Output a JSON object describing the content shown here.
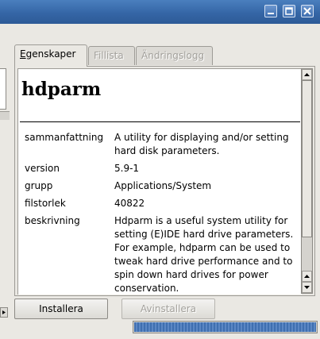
{
  "window": {
    "buttons": [
      {
        "name": "minimize-button",
        "icon": "minimize-icon"
      },
      {
        "name": "maximize-button",
        "icon": "maximize-icon"
      },
      {
        "name": "close-button",
        "icon": "close-icon"
      }
    ]
  },
  "tabs": [
    {
      "label": "Egenskaper",
      "active": true
    },
    {
      "label": "Fillista",
      "active": false
    },
    {
      "label": "Ändringslogg",
      "active": false
    }
  ],
  "package": {
    "name": "hdparm",
    "fields": [
      {
        "key": "sammanfattning",
        "value": "A utility for displaying and/or setting hard disk parameters."
      },
      {
        "key": "version",
        "value": "5.9-1"
      },
      {
        "key": "grupp",
        "value": "Applications/System"
      },
      {
        "key": "filstorlek",
        "value": "40822"
      },
      {
        "key": "beskrivning",
        "value": "Hdparm is a useful system utility for setting (E)IDE hard drive parameters. For example, hdparm can be used to tweak hard drive performance and to spin down hard drives for power conservation."
      }
    ]
  },
  "actions": {
    "install": "Installera",
    "uninstall": "Avinstallera"
  },
  "progress": {
    "fraction": 1.0
  },
  "colors": {
    "titlebar": "#3566a6",
    "progress": "#3f6fb0"
  }
}
